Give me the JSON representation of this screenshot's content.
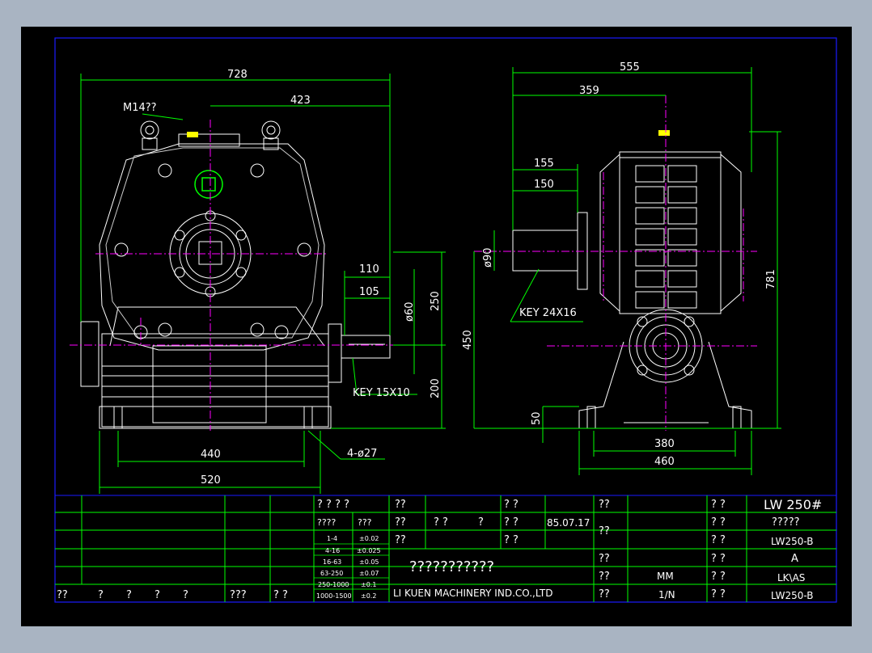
{
  "left_view": {
    "dims": {
      "overall": "728",
      "half": "423",
      "eyebolt": "M14??",
      "shaft_110": "110",
      "shaft_105": "105",
      "shaft_dia": "ø60",
      "height_upper": "250",
      "height_lower": "200",
      "key": "KEY 15X10",
      "base_440": "440",
      "base_520": "520",
      "holes": "4-ø27"
    }
  },
  "right_view": {
    "dims": {
      "overall": "555",
      "to_center": "359",
      "shaft_155": "155",
      "shaft_150": "150",
      "shaft_dia": "ø90",
      "key": "KEY 24X16",
      "center_height": "450",
      "total_height": "781",
      "base_thk": "50",
      "base_380": "380",
      "base_460": "460"
    }
  },
  "title_block": {
    "r1_c1": "? ? ? ?",
    "r1_c2": "??",
    "r1_c3": "? ?",
    "r1_c4": "??",
    "r1_c5": "? ?",
    "model": "LW 250#",
    "r2_a": "????",
    "r2_b": "???",
    "r2_c": "??",
    "r2_d": "? ?",
    "r2_e": "?",
    "r2_f": "? ?",
    "date": "85.07.17",
    "r2_g": "??",
    "r2_h": "? ?",
    "r2_i": "?????",
    "r3_a": "??",
    "r3_b": "? ?",
    "r3_c": "? ?",
    "code1": "LW250-B",
    "r4_a": "??",
    "r4_b": "? ?",
    "rev": "A",
    "r5_a": "??",
    "unit": "MM",
    "r5_b": "? ?",
    "mat": "LK\\AS",
    "r6_a": "??",
    "scale": "1/N",
    "r6_b": "? ?",
    "code2": "LW250-B",
    "bottom_1": "??",
    "bottom_2": "?",
    "bottom_3": "?",
    "bottom_4": "?",
    "bottom_5": "?",
    "bottom_6": "???",
    "bottom_7": "? ?",
    "company_cn": "???????????",
    "company": "LI KUEN MACHINERY IND.CO.,LTD",
    "tol_1": "1-4",
    "tol_1v": "±0.02",
    "tol_2": "4-16",
    "tol_2v": "±0.025",
    "tol_3": "16-63",
    "tol_3v": "±0.05",
    "tol_4": "63-250",
    "tol_4v": "±0.07",
    "tol_5": "250-1000",
    "tol_5v": "±0.1",
    "tol_6": "1000-1500",
    "tol_6v": "±0.2"
  },
  "colors": {
    "dim": "#00ff00",
    "outline": "#ffffff",
    "center": "#ff00ff",
    "frame": "#0000ff",
    "accent": "#ffff00"
  }
}
